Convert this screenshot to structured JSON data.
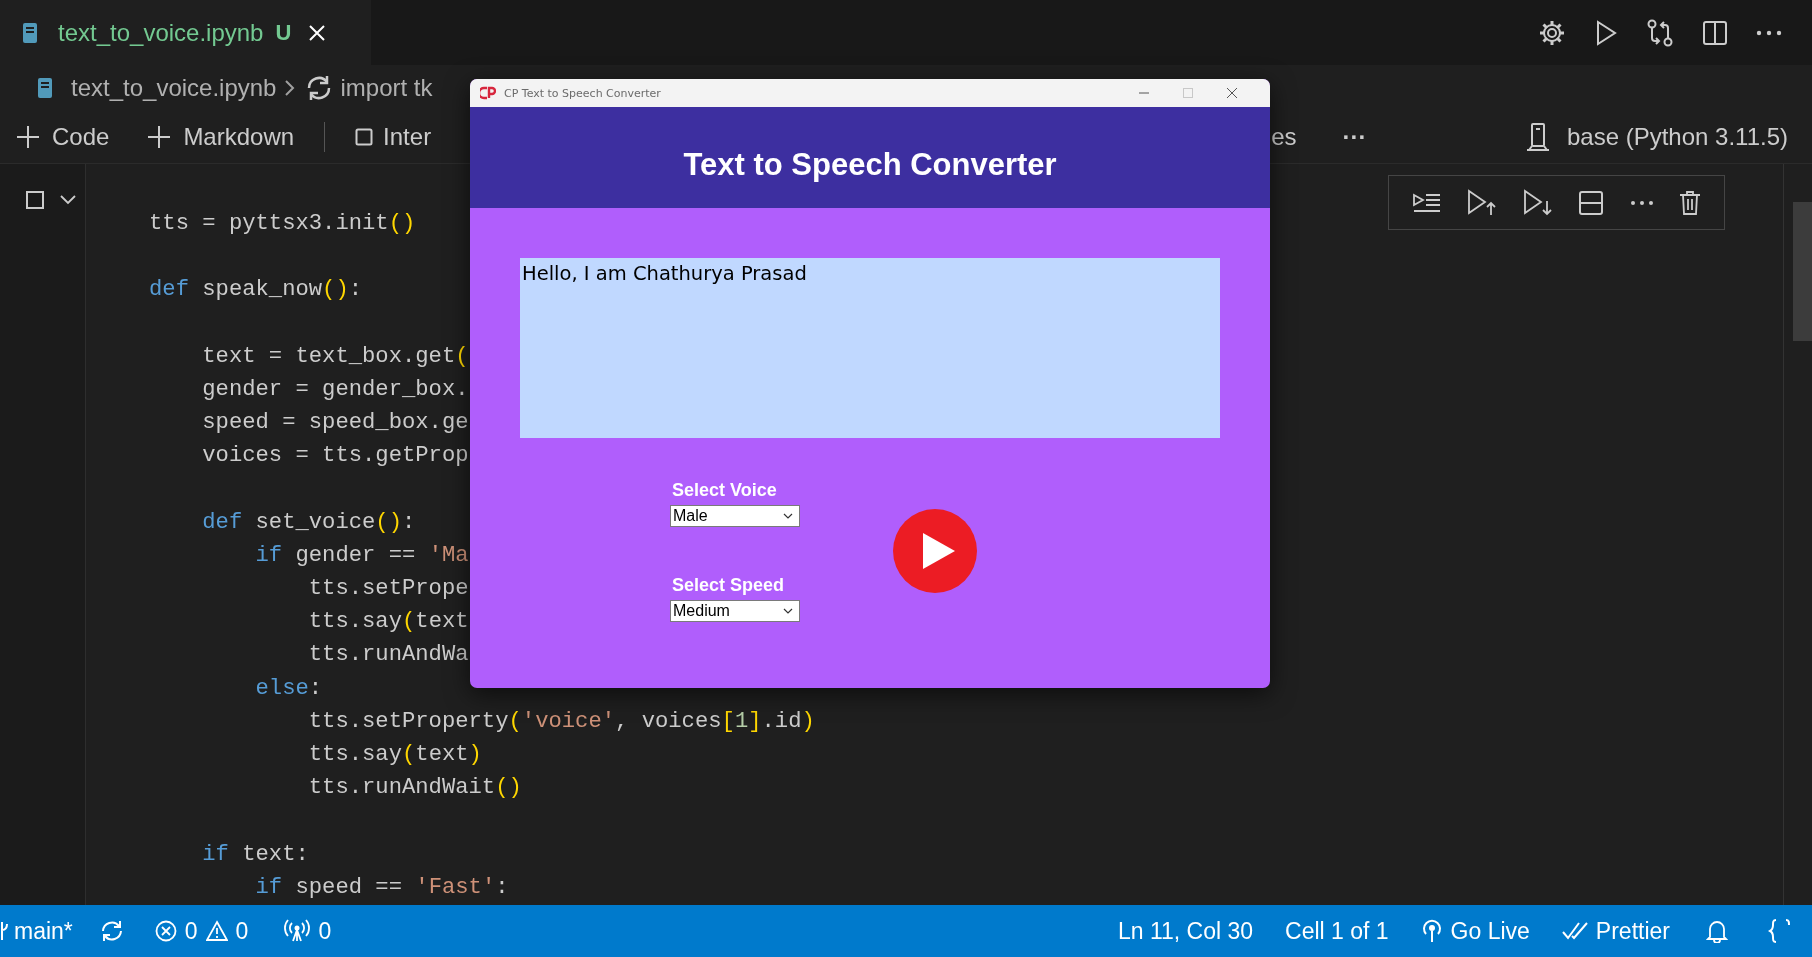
{
  "editor_tabs": [
    {
      "label": "text_to_voice.ipynb",
      "status": "U",
      "selected": true
    }
  ],
  "breadcrumb": [
    "text_to_voice.ipynb",
    "import tk"
  ],
  "notebook_toolbar": {
    "code": "Code",
    "markdown": "Markdown",
    "interrupt": "Inter",
    "variables": "es",
    "more": "···",
    "kernel": "base (Python 3.11.5)"
  },
  "code_lines": [
    {
      "kind": "code",
      "tokens": [
        {
          "kind": "plain",
          "text": "tts = pyttsx3.init"
        },
        {
          "kind": "bracket",
          "text": "()"
        }
      ]
    },
    {
      "kind": "blank"
    },
    {
      "kind": "code",
      "tokens": [
        {
          "kind": "keyword",
          "text": "def"
        },
        {
          "kind": "plain",
          "text": " speak_now"
        },
        {
          "kind": "bracket",
          "text": "()"
        },
        {
          "kind": "plain",
          "text": ":"
        }
      ]
    },
    {
      "kind": "blank"
    },
    {
      "kind": "code",
      "tokens": [
        {
          "kind": "plain",
          "text": "    text = text_box.get"
        },
        {
          "kind": "bracket",
          "text": "("
        }
      ]
    },
    {
      "kind": "code",
      "tokens": [
        {
          "kind": "plain",
          "text": "    gender = gender_box."
        }
      ]
    },
    {
      "kind": "code",
      "tokens": [
        {
          "kind": "plain",
          "text": "    speed = speed_box.ge"
        }
      ]
    },
    {
      "kind": "code",
      "tokens": [
        {
          "kind": "plain",
          "text": "    voices = tts.getProp"
        }
      ]
    },
    {
      "kind": "blank"
    },
    {
      "kind": "code",
      "tokens": [
        {
          "kind": "keyword",
          "text": "    def"
        },
        {
          "kind": "plain",
          "text": " set_voice"
        },
        {
          "kind": "bracket",
          "text": "()"
        },
        {
          "kind": "plain",
          "text": ":"
        }
      ]
    },
    {
      "kind": "code",
      "tokens": [
        {
          "kind": "keyword",
          "text": "        if"
        },
        {
          "kind": "plain",
          "text": " gender == "
        },
        {
          "kind": "string",
          "text": "'Ma"
        }
      ]
    },
    {
      "kind": "code",
      "tokens": [
        {
          "kind": "plain",
          "text": "            tts.setPrope"
        }
      ]
    },
    {
      "kind": "code",
      "tokens": [
        {
          "kind": "plain",
          "text": "            tts.say"
        },
        {
          "kind": "bracket",
          "text": "("
        },
        {
          "kind": "plain",
          "text": "text"
        }
      ]
    },
    {
      "kind": "code",
      "tokens": [
        {
          "kind": "plain",
          "text": "            tts.runAndWa"
        }
      ]
    },
    {
      "kind": "code",
      "tokens": [
        {
          "kind": "keyword",
          "text": "        else"
        },
        {
          "kind": "plain",
          "text": ":"
        }
      ]
    },
    {
      "kind": "code",
      "tokens": [
        {
          "kind": "plain",
          "text": "            tts.setProperty"
        },
        {
          "kind": "bracket",
          "text": "("
        },
        {
          "kind": "string",
          "text": "'voice'"
        },
        {
          "kind": "plain",
          "text": ", voices"
        },
        {
          "kind": "bracket",
          "text": "["
        },
        {
          "kind": "number",
          "text": "1"
        },
        {
          "kind": "bracket",
          "text": "]"
        },
        {
          "kind": "plain",
          "text": ".id"
        },
        {
          "kind": "bracket",
          "text": ")"
        }
      ]
    },
    {
      "kind": "code",
      "tokens": [
        {
          "kind": "plain",
          "text": "            tts.say"
        },
        {
          "kind": "bracket",
          "text": "("
        },
        {
          "kind": "plain",
          "text": "text"
        },
        {
          "kind": "bracket",
          "text": ")"
        }
      ]
    },
    {
      "kind": "code",
      "tokens": [
        {
          "kind": "plain",
          "text": "            tts.runAndWait"
        },
        {
          "kind": "bracket",
          "text": "()"
        }
      ]
    },
    {
      "kind": "blank"
    },
    {
      "kind": "code",
      "tokens": [
        {
          "kind": "keyword",
          "text": "    if"
        },
        {
          "kind": "plain",
          "text": " text:"
        }
      ]
    },
    {
      "kind": "code",
      "tokens": [
        {
          "kind": "keyword",
          "text": "        if"
        },
        {
          "kind": "plain",
          "text": " speed == "
        },
        {
          "kind": "string",
          "text": "'Fast'"
        },
        {
          "kind": "plain",
          "text": ":"
        }
      ]
    }
  ],
  "app_window": {
    "title": "CP Text to Speech Converter",
    "heading": "Text to Speech Converter",
    "text_value": "Hello, I am Chathurya Prasad",
    "voice_label": "Select Voice",
    "voice_value": "Male",
    "speed_label": "Select Speed",
    "speed_value": "Medium"
  },
  "status_bar": {
    "branch": "main*",
    "errors": "0",
    "warnings": "0",
    "ports": "0",
    "position": "Ln 11, Col 30",
    "cell": "Cell 1 of 1",
    "go_live": "Go Live",
    "formatter": "Prettier"
  }
}
